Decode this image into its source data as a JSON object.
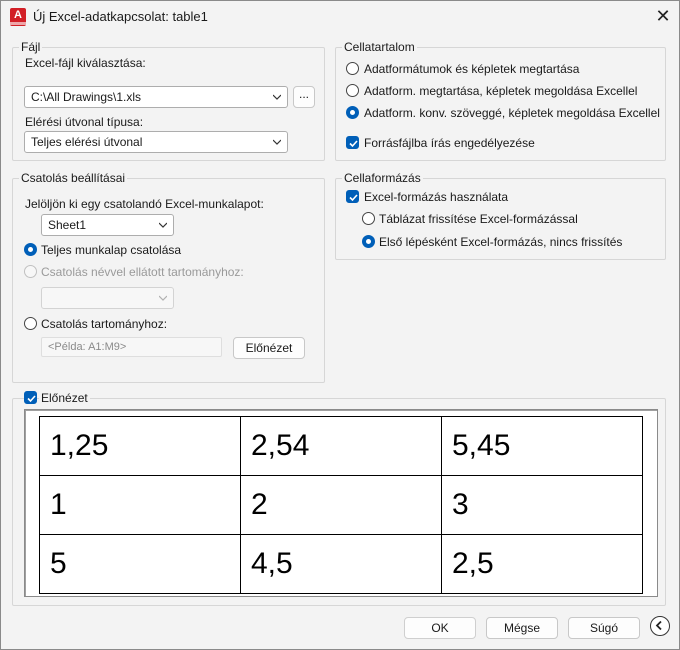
{
  "window": {
    "title": "Új Excel-adatkapcsolat: table1",
    "close": "✕"
  },
  "file": {
    "group_title": "Fájl",
    "choose_label": "Excel-fájl kiválasztása:",
    "file_value": "C:\\All Drawings\\1.xls",
    "browse_label": "...",
    "path_type_label": "Elérési útvonal típusa:",
    "path_type_value": "Teljes elérési útvonal"
  },
  "cell_content": {
    "group_title": "Cellatartalom",
    "options": [
      "Adatformátumok és képletek megtartása",
      "Adatform. megtartása, képletek megoldása Excellel",
      "Adatform. konv. szöveggé, képletek megoldása Excellel"
    ],
    "allow_write": "Forrásfájlba írás engedélyezése"
  },
  "link": {
    "group_title": "Csatolás beállításai",
    "select_sheet_label": "Jelöljön ki egy csatolandó Excel-munkalapot:",
    "sheet_value": "Sheet1",
    "full_sheet": "Teljes munkalap csatolása",
    "named_range": "Csatolás névvel ellátott tartományhoz:",
    "range": "Csatolás tartományhoz:",
    "range_placeholder": "<Példa: A1:M9>",
    "preview_button": "Előnézet"
  },
  "cell_format": {
    "group_title": "Cellaformázás",
    "use_excel": "Excel-formázás használata",
    "refresh_table": "Táblázat frissítése Excel-formázással",
    "first_step": "Első lépésként Excel-formázás, nincs frissítés"
  },
  "preview": {
    "label": "Előnézet",
    "rows": [
      [
        "1,25",
        "2,54",
        "5,45"
      ],
      [
        "1",
        "2",
        "3"
      ],
      [
        "5",
        "4,5",
        "2,5"
      ]
    ]
  },
  "buttons": {
    "ok": "OK",
    "cancel": "Mégse",
    "help": "Súgó"
  }
}
